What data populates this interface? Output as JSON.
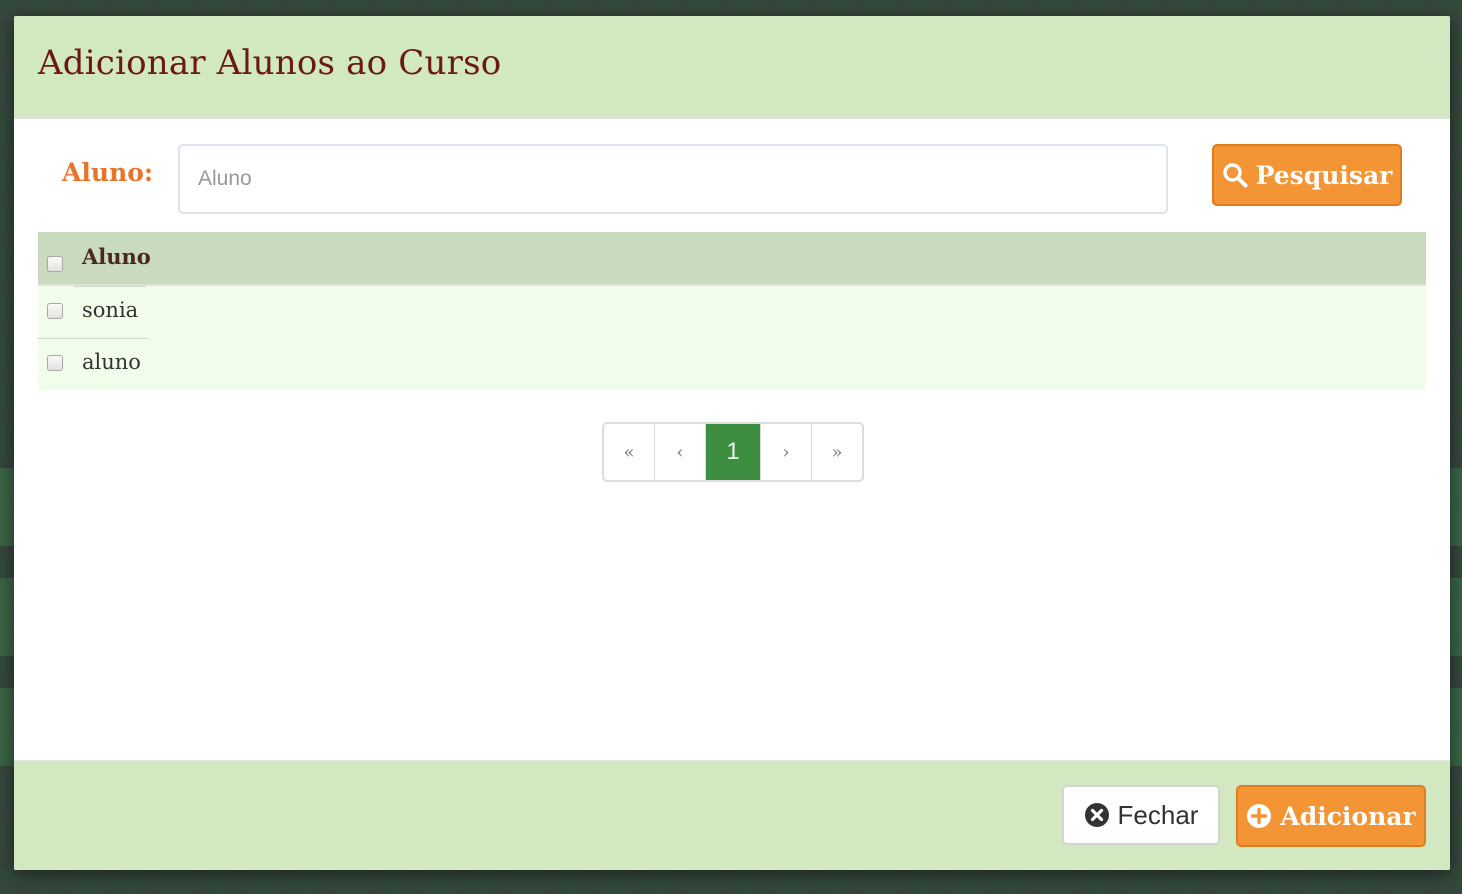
{
  "modal": {
    "title": "Adicionar Alunos ao Curso"
  },
  "search": {
    "label": "Aluno:",
    "placeholder": "Aluno",
    "value": "",
    "button_label": "Pesquisar"
  },
  "table": {
    "header": "Aluno",
    "rows": [
      {
        "name": "sonia",
        "checked": false
      },
      {
        "name": "aluno",
        "checked": false
      }
    ]
  },
  "pagination": {
    "first": "«",
    "prev": "‹",
    "current": "1",
    "next": "›",
    "last": "»"
  },
  "footer": {
    "close_label": "Fechar",
    "add_label": "Adicionar"
  },
  "colors": {
    "header_bg": "#d1e8c1",
    "title": "#6b1a12",
    "accent_orange": "#f39535",
    "active_page": "#3e8e41"
  },
  "icons": {
    "search": "search-icon",
    "close": "times-circle-icon",
    "add": "plus-circle-icon"
  }
}
